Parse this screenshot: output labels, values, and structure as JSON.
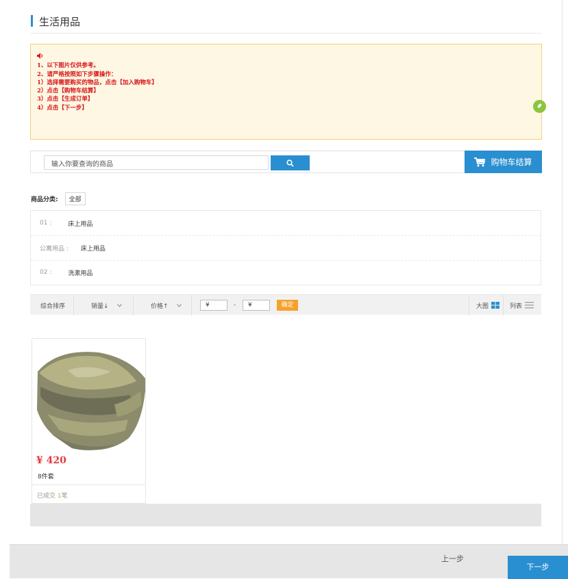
{
  "page": {
    "title": "生活用品"
  },
  "notice": {
    "lines": [
      "1、以下图片仅供参考。",
      "2、请严格按照如下步骤操作：",
      "1）选择需要购买的物品，点击【加入购物车】",
      "2）点击【购物车结算】",
      "3）点击【生成订单】",
      "4）点击【下一步】"
    ]
  },
  "search": {
    "placeholder": "输入你要查询的商品",
    "cart_label": "购物车结算"
  },
  "category": {
    "label": "商品分类:",
    "all": "全部",
    "rows": [
      {
        "key": "01 :",
        "value": "床上用品"
      },
      {
        "key": "公寓用品 :",
        "value": "床上用品"
      },
      {
        "key": "02 :",
        "value": "洗漱用品"
      }
    ]
  },
  "sort": {
    "general": "综合排序",
    "sales": "销量↓",
    "price": "价格↑",
    "currency": "¥",
    "dash": "-",
    "confirm": "确定",
    "big_view": "大图",
    "list_view": "列表"
  },
  "products": [
    {
      "price": "¥ 420",
      "name": "8件套",
      "sold_prefix": "已成交",
      "sold_count": "1",
      "sold_suffix": "笔"
    }
  ],
  "footer": {
    "prev": "上一步",
    "next": "下一步"
  },
  "colors": {
    "accent": "#2a8fd0",
    "notice_text": "#d9161c",
    "price": "#e4393c",
    "confirm": "#f7a02b"
  }
}
